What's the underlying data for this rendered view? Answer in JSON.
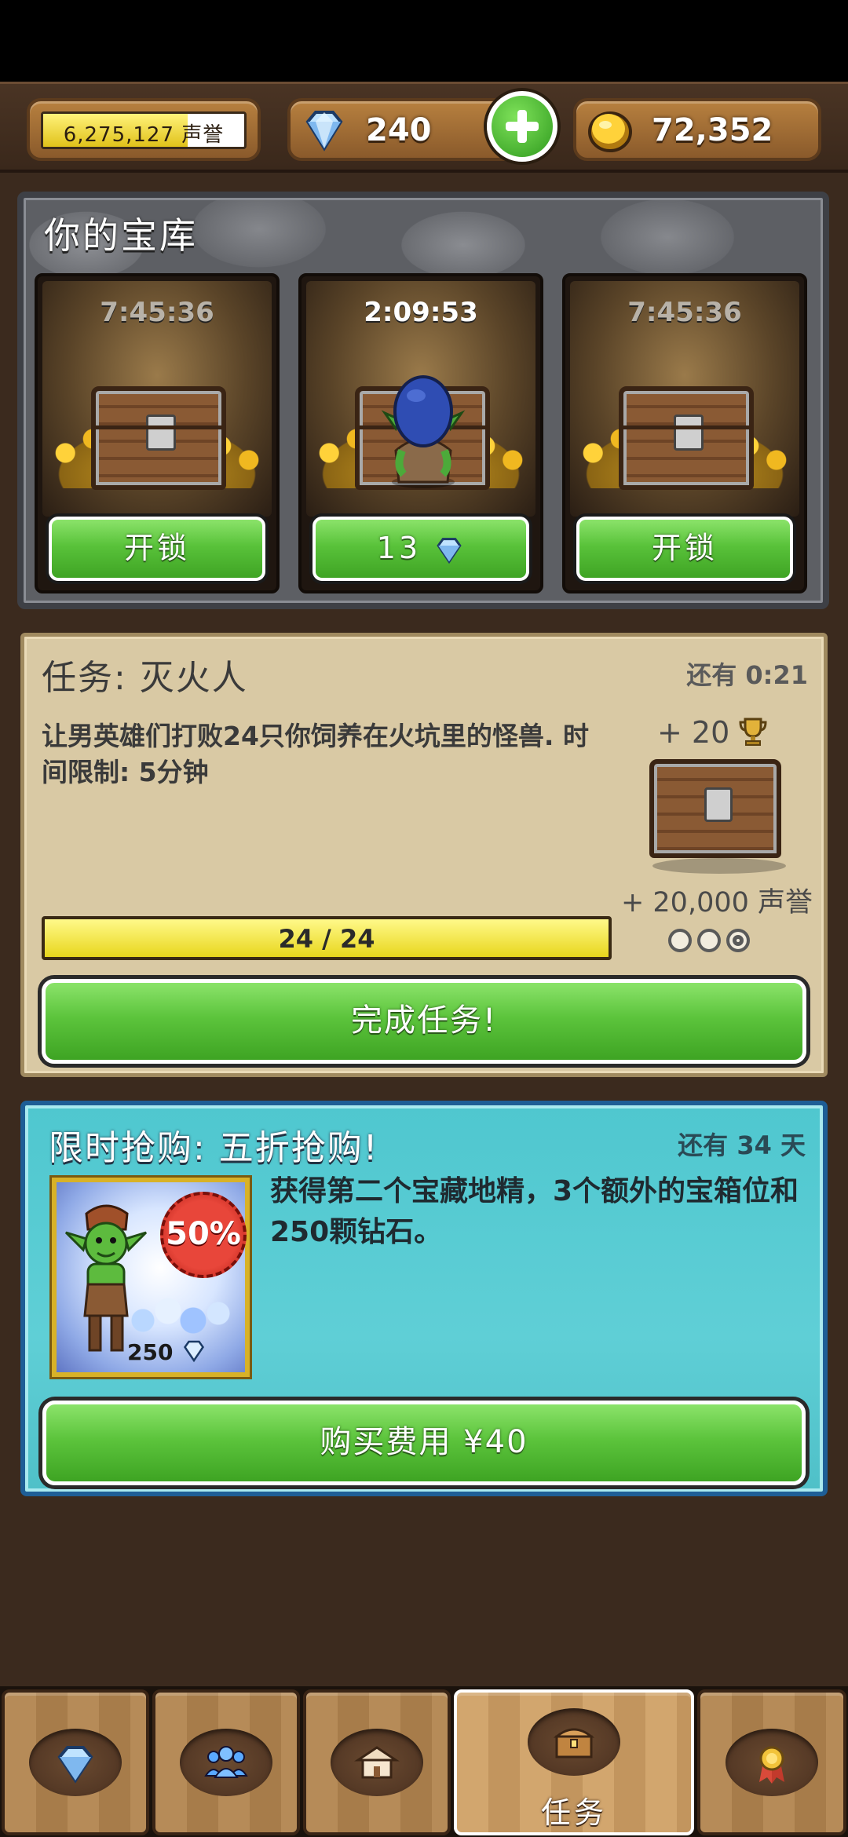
{
  "topbar": {
    "reputation_value": "6,275,127",
    "reputation_unit": "声誉",
    "reputation_fill_fraction": 0.72,
    "gems": "240",
    "gold": "72,352",
    "gem_icon": "diamond-icon",
    "gold_icon": "gold-coin-icon",
    "plus_icon": "plus-icon"
  },
  "vault": {
    "title": "你的宝库",
    "slots": [
      {
        "timer": "7:45:36",
        "button_label": "开锁",
        "state": "locked"
      },
      {
        "timer": "2:09:53",
        "button_label": "13",
        "button_icon": "diamond-icon",
        "state": "unlocking",
        "occupant": "goblin"
      },
      {
        "timer": "7:45:36",
        "button_label": "开锁",
        "state": "locked"
      }
    ]
  },
  "quest": {
    "title": "任务: 灭火人",
    "time_left": "还有 0:21",
    "description": "让男英雄们打败24只你饲养在火坑里的怪兽. 时间限制: 5分钟",
    "reward_trophy": "+ 20",
    "reward_reputation": "+ 20,000 声誉",
    "progress_text": "24 / 24",
    "progress_fraction": 1.0,
    "stars": [
      false,
      false,
      true
    ],
    "button_label": "完成任务!"
  },
  "offer": {
    "title": "限时抢购: 五折抢购!",
    "time_left": "还有 34 天",
    "description": "获得第二个宝藏地精，3个额外的宝箱位和250颗钻石。",
    "badge": "50%",
    "gem_count": "250",
    "button_label": "购买费用 ¥40"
  },
  "nav": {
    "tabs": [
      {
        "icon": "diamond-icon",
        "label": "",
        "active": false
      },
      {
        "icon": "people-icon",
        "label": "",
        "active": false
      },
      {
        "icon": "buildings-icon",
        "label": "",
        "active": false
      },
      {
        "icon": "treasure-chest-icon",
        "label": "任务",
        "active": true
      },
      {
        "icon": "medal-icon",
        "label": "",
        "active": false
      }
    ]
  },
  "colors": {
    "green_button": "#5cc43c",
    "quest_panel": "#d9c9a4",
    "offer_panel": "#4fc7cf",
    "progress_fill": "#e8d61c"
  }
}
